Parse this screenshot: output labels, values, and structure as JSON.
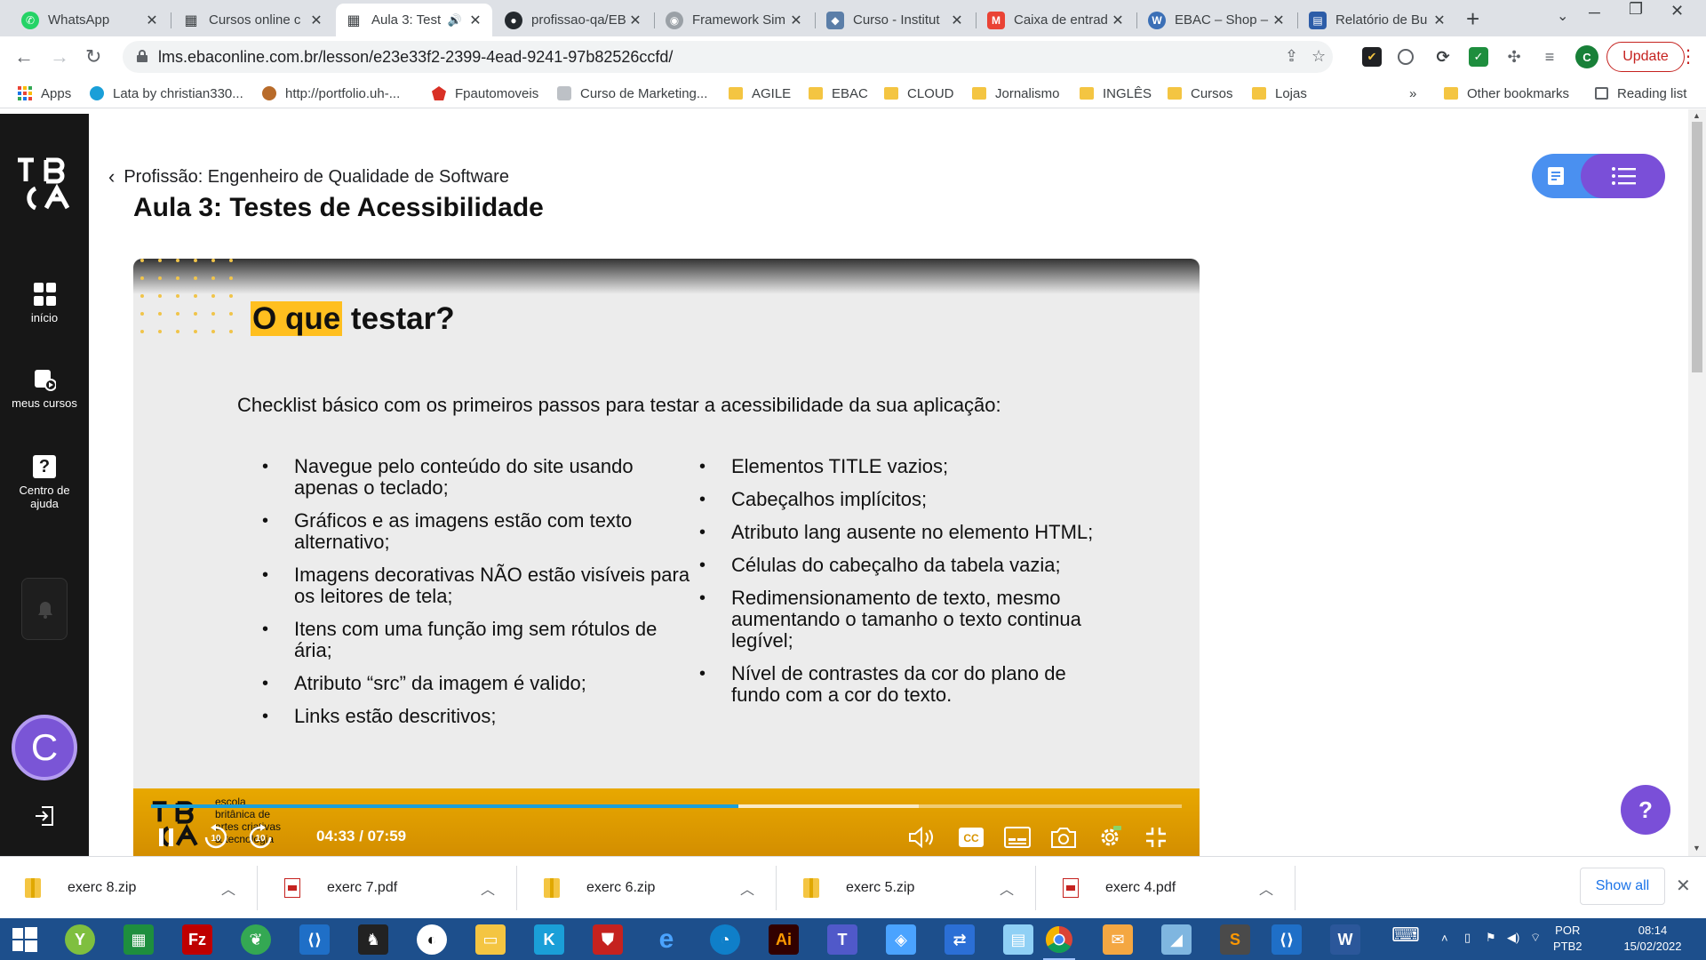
{
  "tabs": [
    {
      "title": "WhatsApp",
      "color": "#25d366",
      "glyph": "✆"
    },
    {
      "title": "Cursos online c",
      "color": "#3c4043",
      "glyph": "▦"
    },
    {
      "title": "Aula 3: Test",
      "color": "#3c4043",
      "glyph": "▦",
      "active": true
    },
    {
      "title": "profissao-qa/EB",
      "color": "#24292e",
      "glyph": "●"
    },
    {
      "title": "Framework Sim",
      "color": "#9aa0a6",
      "glyph": "◉"
    },
    {
      "title": "Curso - Institut",
      "color": "#5b7ea8",
      "glyph": "◆"
    },
    {
      "title": "Caixa de entrad",
      "color": "#ea4335",
      "glyph": "M"
    },
    {
      "title": "EBAC – Shop –",
      "color": "#3b6fb6",
      "glyph": "W"
    },
    {
      "title": "Relatório de Bu",
      "color": "#2d5da8",
      "glyph": "▤"
    }
  ],
  "toolbar": {
    "url": "lms.ebaconline.com.br/lesson/e23e33f2-2399-4ead-9241-97b82526ccfd/",
    "update_label": "Update",
    "profile_initial": "C"
  },
  "bookmarks": {
    "apps_label": "Apps",
    "items": [
      "Lata by christian330...",
      "http://portfolio.uh-...",
      "Fpautomoveis",
      "Curso de Marketing...",
      "AGILE",
      "EBAC",
      "CLOUD",
      "Jornalismo",
      "INGLÊS",
      "Cursos",
      "Lojas"
    ],
    "overflow": "»",
    "other": "Other bookmarks",
    "reading": "Reading list"
  },
  "sidebar": {
    "items": [
      {
        "label": "início"
      },
      {
        "label": "meus cursos"
      },
      {
        "label": "Centro de ajuda"
      }
    ],
    "avatar_initial": "C"
  },
  "lesson": {
    "breadcrumb": "Profissão: Engenheiro de Qualidade de Software",
    "title": "Aula 3: Testes de Acessibilidade"
  },
  "slide": {
    "title_highlight": "O que",
    "title_rest": " testar?",
    "intro": "Checklist básico com os primeiros passos para testar a acessibilidade da sua aplicação:",
    "left": [
      "Navegue pelo conteúdo do site usando apenas o teclado;",
      "Gráficos e as imagens estão com texto alternativo;",
      "Imagens decorativas NÃO estão visíveis para os leitores de tela;",
      "Itens com uma função img sem rótulos de ária;",
      "Atributo “src” da imagem é valido;",
      "Links estão descritivos;"
    ],
    "right": [
      "Elementos TITLE vazios;",
      "Cabeçalhos implícitos;",
      "Atributo lang ausente no elemento HTML;",
      "Células do cabeçalho da tabela vazia;",
      "Redimensionamento de texto, mesmo aumentando o tamanho o texto continua legível;",
      "Nível de contrastes da cor do plano de fundo com a cor do texto."
    ]
  },
  "player": {
    "school": [
      "escola",
      "britânica de",
      "artes criativas",
      "& tecnologia"
    ],
    "time": "04:33 / 07:59",
    "progress": 0.57,
    "buffered": 0.745,
    "skip": "10"
  },
  "downloads": {
    "items": [
      {
        "name": "exerc 8.zip",
        "kind": "zip"
      },
      {
        "name": "exerc 7.pdf",
        "kind": "pdf"
      },
      {
        "name": "exerc 6.zip",
        "kind": "zip"
      },
      {
        "name": "exerc 5.zip",
        "kind": "zip"
      },
      {
        "name": "exerc 4.pdf",
        "kind": "pdf"
      }
    ],
    "show_all": "Show all"
  },
  "taskbar": {
    "lang": "POR",
    "layout": "PTB2",
    "time": "08:14",
    "date": "15/02/2022"
  }
}
